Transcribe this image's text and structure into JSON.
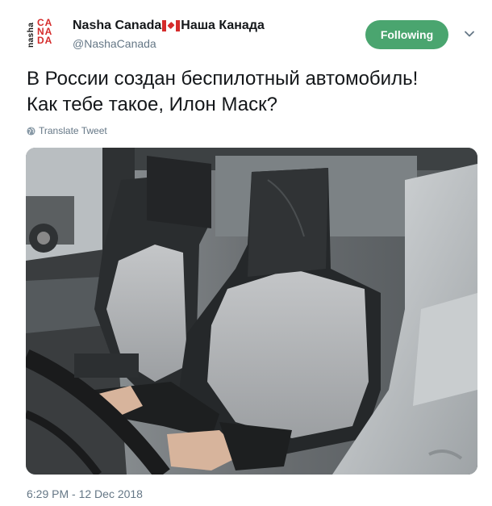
{
  "user": {
    "display_name": "Nasha Canada",
    "display_name_ru": "Наша Канада",
    "handle": "@NashaCanada",
    "avatar_text_vertical": "nasha",
    "avatar_text_main": "CANADA"
  },
  "follow_button": {
    "label": "Following"
  },
  "tweet": {
    "line1": "В России создан беспилотный автомобиль!",
    "line2": "Как тебе такое, Илон Маск?"
  },
  "translate_label": "Translate Tweet",
  "timestamp": "6:29 PM - 12 Dec 2018",
  "colors": {
    "follow_green": "#4aa56f",
    "canada_red": "#d52b2b",
    "secondary_text": "#657786"
  },
  "icons": {
    "caret": "chevron-down-icon",
    "globe": "globe-icon",
    "flag": "canada-flag-icon"
  }
}
